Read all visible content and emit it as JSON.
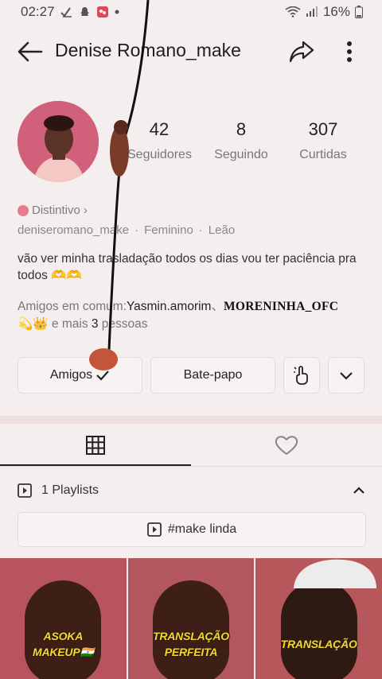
{
  "status_bar": {
    "time": "02:27",
    "battery": "16%"
  },
  "header": {
    "title": "Denise Romano_make"
  },
  "profile": {
    "stats": [
      {
        "value": "42",
        "label": "Seguidores"
      },
      {
        "value": "8",
        "label": "Seguindo"
      },
      {
        "value": "307",
        "label": "Curtidas"
      }
    ],
    "badge_label": "Distintivo",
    "badge_chevron": "›",
    "username": "deniseromano_make",
    "gender": "Feminino",
    "sign": "Leão",
    "separator": "·",
    "bio": "vão ver minha trasladação todos os dias vou ter paciência pra  todos 🫶🫶",
    "friends_prefix": "Amigos em comum:",
    "friend1": "Yasmin.amorim",
    "friend_sep": "、",
    "friend2": "MORENINHA_OFC",
    "friends_emojis": "💫👑",
    "friends_suffix_a": " e mais ",
    "friends_count": "3",
    "friends_suffix_b": " pessoas"
  },
  "actions": {
    "friends_button": "Amigos",
    "chat_button": "Bate-papo"
  },
  "playlists": {
    "header": "1 Playlists",
    "item": "#make linda"
  },
  "videos": [
    {
      "caption_line1": "ASOKA",
      "caption_line2": "MAKEUP🇮🇳",
      "bg": "#b7545e"
    },
    {
      "caption_line1": "TRANSLAÇÃO",
      "caption_line2": "PERFEITA",
      "bg": "#b1575d"
    },
    {
      "caption_line1": "TRANSLAÇÃO",
      "caption_line2": "",
      "bg": "#b6575c"
    }
  ],
  "colors": {
    "background": "#f4eeee",
    "badge_accent": "#e77c8c",
    "caption_yellow": "#f4d730"
  }
}
